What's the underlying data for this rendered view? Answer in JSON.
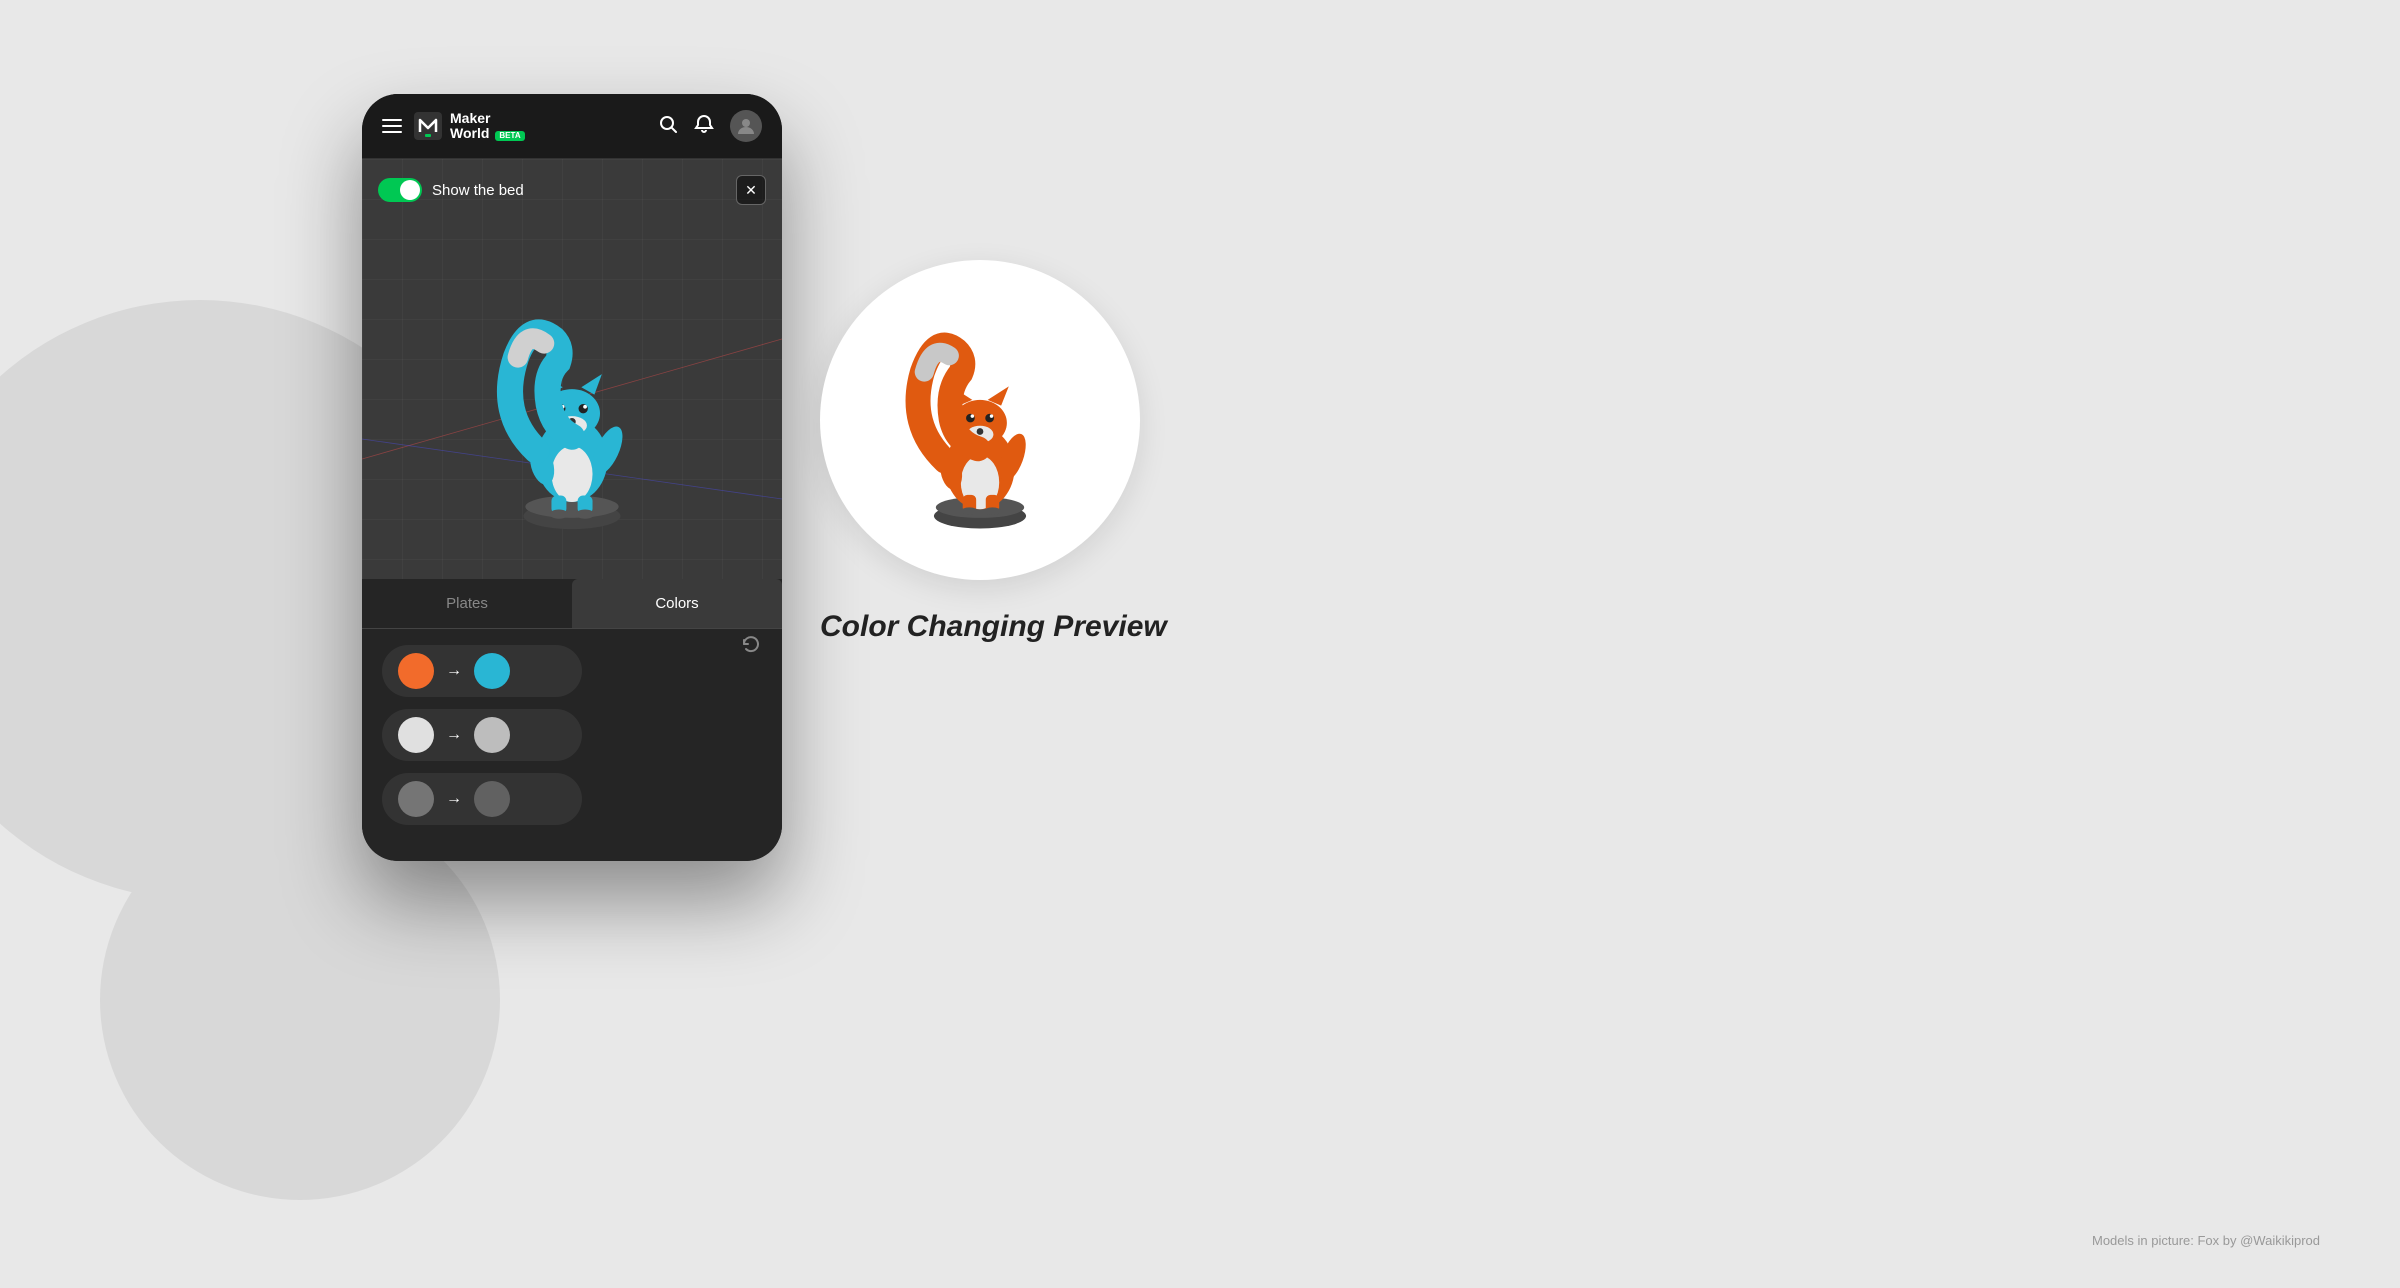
{
  "app": {
    "name": "Maker World",
    "name_line1": "Maker",
    "name_line2": "World",
    "beta": "BETA"
  },
  "header": {
    "search_label": "search",
    "notification_label": "notifications",
    "avatar_label": "user avatar"
  },
  "viewport": {
    "show_bed_label": "Show the bed",
    "toggle_state": "on",
    "close_label": "✕"
  },
  "tabs": [
    {
      "id": "plates",
      "label": "Plates",
      "active": false
    },
    {
      "id": "colors",
      "label": "Colors",
      "active": true
    }
  ],
  "color_rows": [
    {
      "from_color": "#F26B2B",
      "to_color": "#29B6D4",
      "from_label": "orange",
      "to_label": "teal"
    },
    {
      "from_color": "#e0e0e0",
      "to_color": "#bdbdbd",
      "from_label": "light gray",
      "to_label": "gray"
    },
    {
      "from_color": "#757575",
      "to_color": "#616161",
      "from_label": "dark gray",
      "to_label": "dark gray 2"
    }
  ],
  "preview": {
    "title": "Color Changing Preview"
  },
  "attribution": {
    "text": "Models in picture: Fox by @Waikikiprod"
  },
  "icons": {
    "hamburger": "☰",
    "search": "🔍",
    "bell": "🔔",
    "refresh": "↻",
    "arrow_right": "→"
  }
}
